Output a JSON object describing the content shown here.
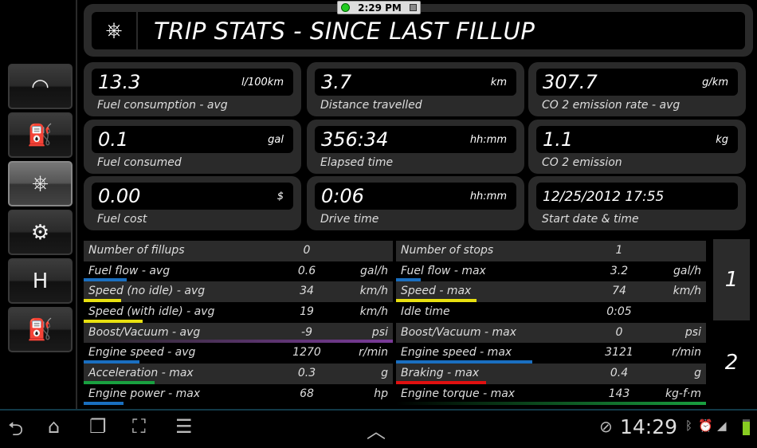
{
  "status_clock": "2:29 PM",
  "sidebar": {
    "items": [
      {
        "name": "dashboard",
        "icon": "gauge-icon",
        "glyph": "◠"
      },
      {
        "name": "fuel",
        "icon": "fuel-pump-icon",
        "glyph": "⛽"
      },
      {
        "name": "trip",
        "icon": "steering-wheel-icon",
        "glyph": "⎈",
        "active": true
      },
      {
        "name": "engine",
        "icon": "engine-icon",
        "glyph": "⚙"
      },
      {
        "name": "gear",
        "icon": "gearshift-icon",
        "glyph": "H"
      },
      {
        "name": "fillup",
        "icon": "fuel-nozzle-icon",
        "glyph": "⛽"
      }
    ]
  },
  "header": {
    "title": "TRIP STATS - SINCE LAST FILLUP",
    "icon": "steering-wheel-icon"
  },
  "cards": [
    {
      "value": "13.3",
      "unit": "l/100km",
      "label": "Fuel consumption - avg"
    },
    {
      "value": "3.7",
      "unit": "km",
      "label": "Distance travelled"
    },
    {
      "value": "307.7",
      "unit": "g/km",
      "label": "CO 2 emission rate - avg"
    },
    {
      "value": "0.1",
      "unit": "gal",
      "label": "Fuel consumed"
    },
    {
      "value": "356:34",
      "unit": "hh:mm",
      "label": "Elapsed time"
    },
    {
      "value": "1.1",
      "unit": "kg",
      "label": "CO 2 emission"
    },
    {
      "value": "0.00",
      "unit": "$",
      "label": "Fuel cost"
    },
    {
      "value": "0:06",
      "unit": "hh:mm",
      "label": "Drive time"
    },
    {
      "value": "12/25/2012 17:55",
      "unit": "",
      "label": "Start date & time"
    }
  ],
  "table_left": [
    {
      "label": "Number of fillups",
      "value": "0",
      "unit": ""
    },
    {
      "label": "Fuel flow - avg",
      "value": "0.6",
      "unit": "gal/h",
      "bar_color": "#1a6fc0",
      "bar_fraction": 0.14
    },
    {
      "label": "Speed (no idle) - avg",
      "value": "34",
      "unit": "km/h",
      "bar_color": "#e8e010",
      "bar_fraction": 0.12
    },
    {
      "label": "Speed (with idle) - avg",
      "value": "19",
      "unit": "km/h",
      "bar_color": "#e8e010",
      "bar_fraction": 0.19
    },
    {
      "label": "Boost/Vacuum - avg",
      "value": "-9",
      "unit": "psi",
      "bar_color": "#7a3a9a",
      "bar_fraction": 1.0
    },
    {
      "label": "Engine speed - avg",
      "value": "1270",
      "unit": "r/min",
      "bar_color": "#1a6fc0",
      "bar_fraction": 0.18
    },
    {
      "label": "Acceleration - max",
      "value": "0.3",
      "unit": "g",
      "bar_color": "#19a040",
      "bar_fraction": 0.23
    },
    {
      "label": "Engine power - max",
      "value": "68",
      "unit": "hp",
      "bar_color": "#1a6fc0",
      "bar_fraction": 0.13
    }
  ],
  "table_right": [
    {
      "label": "Number of stops",
      "value": "1",
      "unit": ""
    },
    {
      "label": "Fuel flow - max",
      "value": "3.2",
      "unit": "gal/h",
      "bar_color": "#1a6fc0",
      "bar_fraction": 0.08
    },
    {
      "label": "Speed - max",
      "value": "74",
      "unit": "km/h",
      "bar_color": "#e8e010",
      "bar_fraction": 0.26
    },
    {
      "label": "Idle time",
      "value": "0:05",
      "unit": ""
    },
    {
      "label": "Boost/Vacuum - max",
      "value": "0",
      "unit": "psi"
    },
    {
      "label": "Engine speed - max",
      "value": "3121",
      "unit": "r/min",
      "bar_color": "#1a6fc0",
      "bar_fraction": 0.44
    },
    {
      "label": "Braking - max",
      "value": "0.4",
      "unit": "g",
      "bar_color": "#e01010",
      "bar_fraction": 0.29
    },
    {
      "label": "Engine torque - max",
      "value": "143",
      "unit": "kg-f·m",
      "bar_color": "#19a040",
      "bar_fraction": 1.0
    }
  ],
  "pages": [
    {
      "label": "1",
      "active": true
    },
    {
      "label": "2",
      "active": false
    }
  ],
  "navbar": {
    "back": "⮌",
    "home": "⌂",
    "recent": "❐",
    "screenshot": "⛶",
    "menu": "☰",
    "up": "︿",
    "clock": "14:29",
    "icons": [
      "usb-debug-icon",
      "bluetooth-icon",
      "alarm-icon",
      "signal-icon",
      "battery-icon"
    ]
  }
}
